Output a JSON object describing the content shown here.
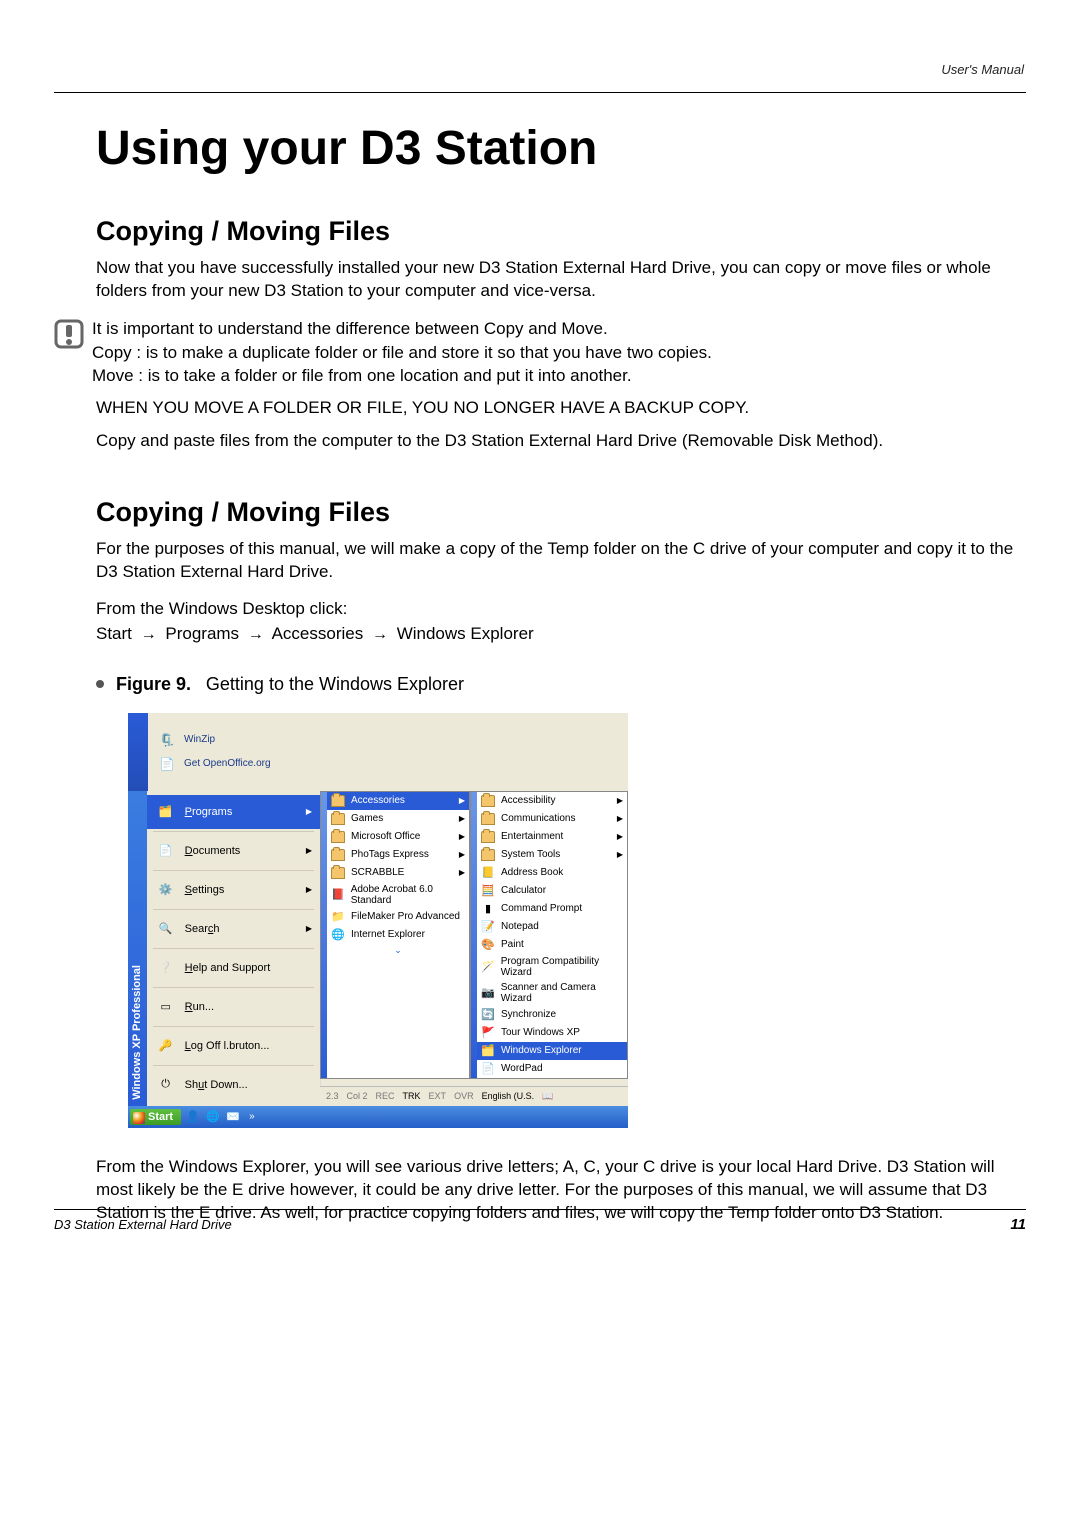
{
  "header": {
    "manual": "User's Manual"
  },
  "title": "Using your D3 Station",
  "section1": {
    "heading": "Copying / Moving Files",
    "p1": "Now that you have successfully installed your new D3 Station External Hard Drive, you can copy or move files or whole folders from your new D3 Station to your computer and vice-versa.",
    "notice_l1": "It is important to understand the difference between Copy and Move.",
    "notice_l2": "Copy : is to make a duplicate folder or file and store it so that you have two copies.",
    "notice_l3": "Move : is to take a folder or file from one location and put it into another.",
    "warn": "WHEN YOU MOVE A FOLDER OR FILE, YOU NO LONGER HAVE A BACKUP COPY.",
    "p2": "Copy and paste files from the computer to the D3 Station External Hard Drive (Removable Disk Method)."
  },
  "section2": {
    "heading": "Copying / Moving Files",
    "p1": "For the purposes of this manual, we will make a copy of the Temp folder on the C drive of your computer and copy it to the D3 Station External Hard Drive.",
    "p2": "From the Windows Desktop click:",
    "path_start": "Start",
    "path_programs": "Programs",
    "path_acc": "Accessories",
    "path_we": "Windows Explorer"
  },
  "figure": {
    "label": "Figure 9.",
    "caption": "Getting to the Windows Explorer"
  },
  "start": {
    "top": [
      {
        "icon": "winzip-icon",
        "label": "WinZip"
      },
      {
        "icon": "ooo-icon",
        "label": "Get OpenOffice.org"
      }
    ],
    "strip": "Windows XP Professional",
    "left": [
      {
        "icon": "programs-icon",
        "label": "Programs",
        "arrow": true,
        "hl": true
      },
      {
        "icon": "documents-icon",
        "label": "Documents",
        "arrow": true
      },
      {
        "icon": "settings-icon",
        "label": "Settings",
        "arrow": true
      },
      {
        "icon": "search-icon",
        "label": "Search",
        "arrow": true
      },
      {
        "icon": "help-icon",
        "label": "Help and Support"
      },
      {
        "icon": "run-icon",
        "label": "Run..."
      },
      {
        "icon": "logoff-icon",
        "label": "Log Off l.bruton..."
      },
      {
        "icon": "shutdown-icon",
        "label": "Shut Down..."
      }
    ],
    "menu2": [
      {
        "label": "Accessories",
        "arrow": true,
        "hl": true
      },
      {
        "label": "Games",
        "arrow": true
      },
      {
        "label": "Microsoft Office",
        "arrow": true
      },
      {
        "label": "PhoTags Express",
        "arrow": true
      },
      {
        "label": "SCRABBLE",
        "arrow": true
      },
      {
        "label": "Adobe Acrobat 6.0 Standard"
      },
      {
        "label": "FileMaker Pro Advanced"
      },
      {
        "label": "Internet Explorer"
      }
    ],
    "menu3": [
      {
        "label": "Accessibility",
        "arrow": true
      },
      {
        "label": "Communications",
        "arrow": true
      },
      {
        "label": "Entertainment",
        "arrow": true
      },
      {
        "label": "System Tools",
        "arrow": true
      },
      {
        "label": "Address Book"
      },
      {
        "label": "Calculator"
      },
      {
        "label": "Command Prompt"
      },
      {
        "label": "Notepad"
      },
      {
        "label": "Paint"
      },
      {
        "label": "Program Compatibility Wizard"
      },
      {
        "label": "Scanner and Camera Wizard"
      },
      {
        "label": "Synchronize"
      },
      {
        "label": "Tour Windows XP"
      },
      {
        "label": "Windows Explorer",
        "hl": true
      },
      {
        "label": "WordPad"
      }
    ],
    "statusbar": {
      "s1": "2.3",
      "s2": "Col 2",
      "rec": "REC",
      "trk": "TRK",
      "ext": "EXT",
      "ovr": "OVR",
      "lang": "English (U.S."
    },
    "taskbar": {
      "start": "Start"
    }
  },
  "after_fig": "From the Windows Explorer, you will see various drive letters; A, C, your C drive is your local Hard Drive. D3 Station will most likely be the E drive however, it could be any drive letter. For the purposes of this manual, we will assume that D3 Station is the E drive. As well, for practice copying folders and files, we will copy the Temp folder onto D3 Station.",
  "footer": {
    "left": "D3 Station External Hard Drive",
    "page": "11"
  }
}
